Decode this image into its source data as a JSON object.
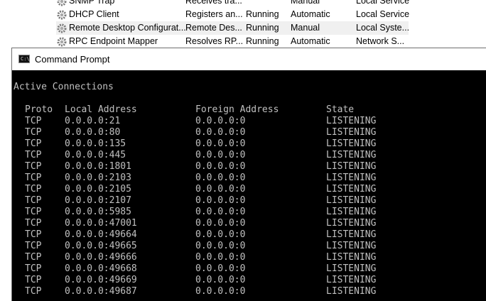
{
  "services": {
    "rows": [
      {
        "name": "SNMP Trap",
        "description": "Receives tra...",
        "status": "",
        "startup": "Manual",
        "logon": "Local Service"
      },
      {
        "name": "DHCP Client",
        "description": "Registers an...",
        "status": "Running",
        "startup": "Automatic",
        "logon": "Local Service"
      },
      {
        "name": "Remote Desktop Configurat...",
        "description": "Remote Des...",
        "status": "Running",
        "startup": "Manual",
        "logon": "Local Syste..."
      },
      {
        "name": "RPC Endpoint Mapper",
        "description": "Resolves RP...",
        "status": "Running",
        "startup": "Automatic",
        "logon": "Network S..."
      }
    ]
  },
  "cmd": {
    "title": "Command Prompt",
    "heading": "Active Connections",
    "headers": {
      "proto": "Proto",
      "local": "Local Address",
      "foreign": "Foreign Address",
      "state": "State"
    },
    "connections": [
      {
        "proto": "TCP",
        "local": "0.0.0.0:21",
        "foreign": "0.0.0.0:0",
        "state": "LISTENING"
      },
      {
        "proto": "TCP",
        "local": "0.0.0.0:80",
        "foreign": "0.0.0.0:0",
        "state": "LISTENING"
      },
      {
        "proto": "TCP",
        "local": "0.0.0.0:135",
        "foreign": "0.0.0.0:0",
        "state": "LISTENING"
      },
      {
        "proto": "TCP",
        "local": "0.0.0.0:445",
        "foreign": "0.0.0.0:0",
        "state": "LISTENING"
      },
      {
        "proto": "TCP",
        "local": "0.0.0.0:1801",
        "foreign": "0.0.0.0:0",
        "state": "LISTENING"
      },
      {
        "proto": "TCP",
        "local": "0.0.0.0:2103",
        "foreign": "0.0.0.0:0",
        "state": "LISTENING"
      },
      {
        "proto": "TCP",
        "local": "0.0.0.0:2105",
        "foreign": "0.0.0.0:0",
        "state": "LISTENING"
      },
      {
        "proto": "TCP",
        "local": "0.0.0.0:2107",
        "foreign": "0.0.0.0:0",
        "state": "LISTENING"
      },
      {
        "proto": "TCP",
        "local": "0.0.0.0:5985",
        "foreign": "0.0.0.0:0",
        "state": "LISTENING"
      },
      {
        "proto": "TCP",
        "local": "0.0.0.0:47001",
        "foreign": "0.0.0.0:0",
        "state": "LISTENING"
      },
      {
        "proto": "TCP",
        "local": "0.0.0.0:49664",
        "foreign": "0.0.0.0:0",
        "state": "LISTENING"
      },
      {
        "proto": "TCP",
        "local": "0.0.0.0:49665",
        "foreign": "0.0.0.0:0",
        "state": "LISTENING"
      },
      {
        "proto": "TCP",
        "local": "0.0.0.0:49666",
        "foreign": "0.0.0.0:0",
        "state": "LISTENING"
      },
      {
        "proto": "TCP",
        "local": "0.0.0.0:49668",
        "foreign": "0.0.0.0:0",
        "state": "LISTENING"
      },
      {
        "proto": "TCP",
        "local": "0.0.0.0:49669",
        "foreign": "0.0.0.0:0",
        "state": "LISTENING"
      },
      {
        "proto": "TCP",
        "local": "0.0.0.0:49687",
        "foreign": "0.0.0.0:0",
        "state": "LISTENING"
      }
    ]
  }
}
